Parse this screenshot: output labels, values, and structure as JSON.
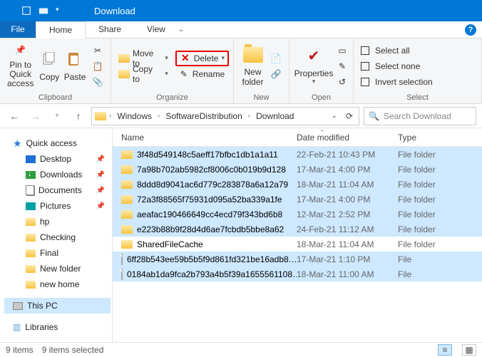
{
  "title": "Download",
  "tabs": {
    "file": "File",
    "home": "Home",
    "share": "Share",
    "view": "View"
  },
  "ribbon": {
    "clipboard": {
      "label": "Clipboard",
      "pin": "Pin to Quick access",
      "copy": "Copy",
      "paste": "Paste"
    },
    "organize": {
      "label": "Organize",
      "moveto": "Move to",
      "copyto": "Copy to",
      "delete": "Delete",
      "rename": "Rename"
    },
    "new": {
      "label": "New",
      "newfolder": "New folder"
    },
    "open": {
      "label": "Open",
      "properties": "Properties"
    },
    "select": {
      "label": "Select",
      "all": "Select all",
      "none": "Select none",
      "invert": "Invert selection"
    }
  },
  "breadcrumb": [
    "Windows",
    "SoftwareDistribution",
    "Download"
  ],
  "search_placeholder": "Search Download",
  "nav": {
    "quick": "Quick access",
    "desktop": "Desktop",
    "downloads": "Downloads",
    "documents": "Documents",
    "pictures": "Pictures",
    "hp": "hp",
    "checking": "Checking",
    "final": "Final",
    "newfolder": "New folder",
    "newhome": "new home",
    "thispc": "This PC",
    "libraries": "Libraries"
  },
  "columns": {
    "name": "Name",
    "date": "Date modified",
    "type": "Type"
  },
  "rows": [
    {
      "name": "3f48d549148c5aeff17bfbc1db1a1a11",
      "date": "22-Feb-21 10:43 PM",
      "type": "File folder",
      "kind": "folder",
      "sel": true
    },
    {
      "name": "7a98b702ab5982cf8006c0b019b9d128",
      "date": "17-Mar-21 4:00 PM",
      "type": "File folder",
      "kind": "folder",
      "sel": true
    },
    {
      "name": "8ddd8d9041ac6d779c283878a6a12a79",
      "date": "18-Mar-21 11:04 AM",
      "type": "File folder",
      "kind": "folder",
      "sel": true
    },
    {
      "name": "72a3f88565f75931d095a52ba339a1fe",
      "date": "17-Mar-21 4:00 PM",
      "type": "File folder",
      "kind": "folder",
      "sel": true
    },
    {
      "name": "aeafac190466649cc4ecd79f343bd6b8",
      "date": "12-Mar-21 2:52 PM",
      "type": "File folder",
      "kind": "folder",
      "sel": true
    },
    {
      "name": "e223b88b9f28d4d6ae7fcbdb5bbe8a62",
      "date": "24-Feb-21 11:12 AM",
      "type": "File folder",
      "kind": "folder",
      "sel": true
    },
    {
      "name": "SharedFileCache",
      "date": "18-Mar-21 11:04 AM",
      "type": "File folder",
      "kind": "folder",
      "sel": false
    },
    {
      "name": "6ff28b543ee59b5b5f9d861fd321be16adb8…",
      "date": "17-Mar-21 1:10 PM",
      "type": "File",
      "kind": "file",
      "sel": true
    },
    {
      "name": "0184ab1da9fca2b793a4b5f39a1655561108…",
      "date": "18-Mar-21 11:00 AM",
      "type": "File",
      "kind": "file",
      "sel": true
    }
  ],
  "status": {
    "items": "9 items",
    "selected": "9 items selected"
  }
}
